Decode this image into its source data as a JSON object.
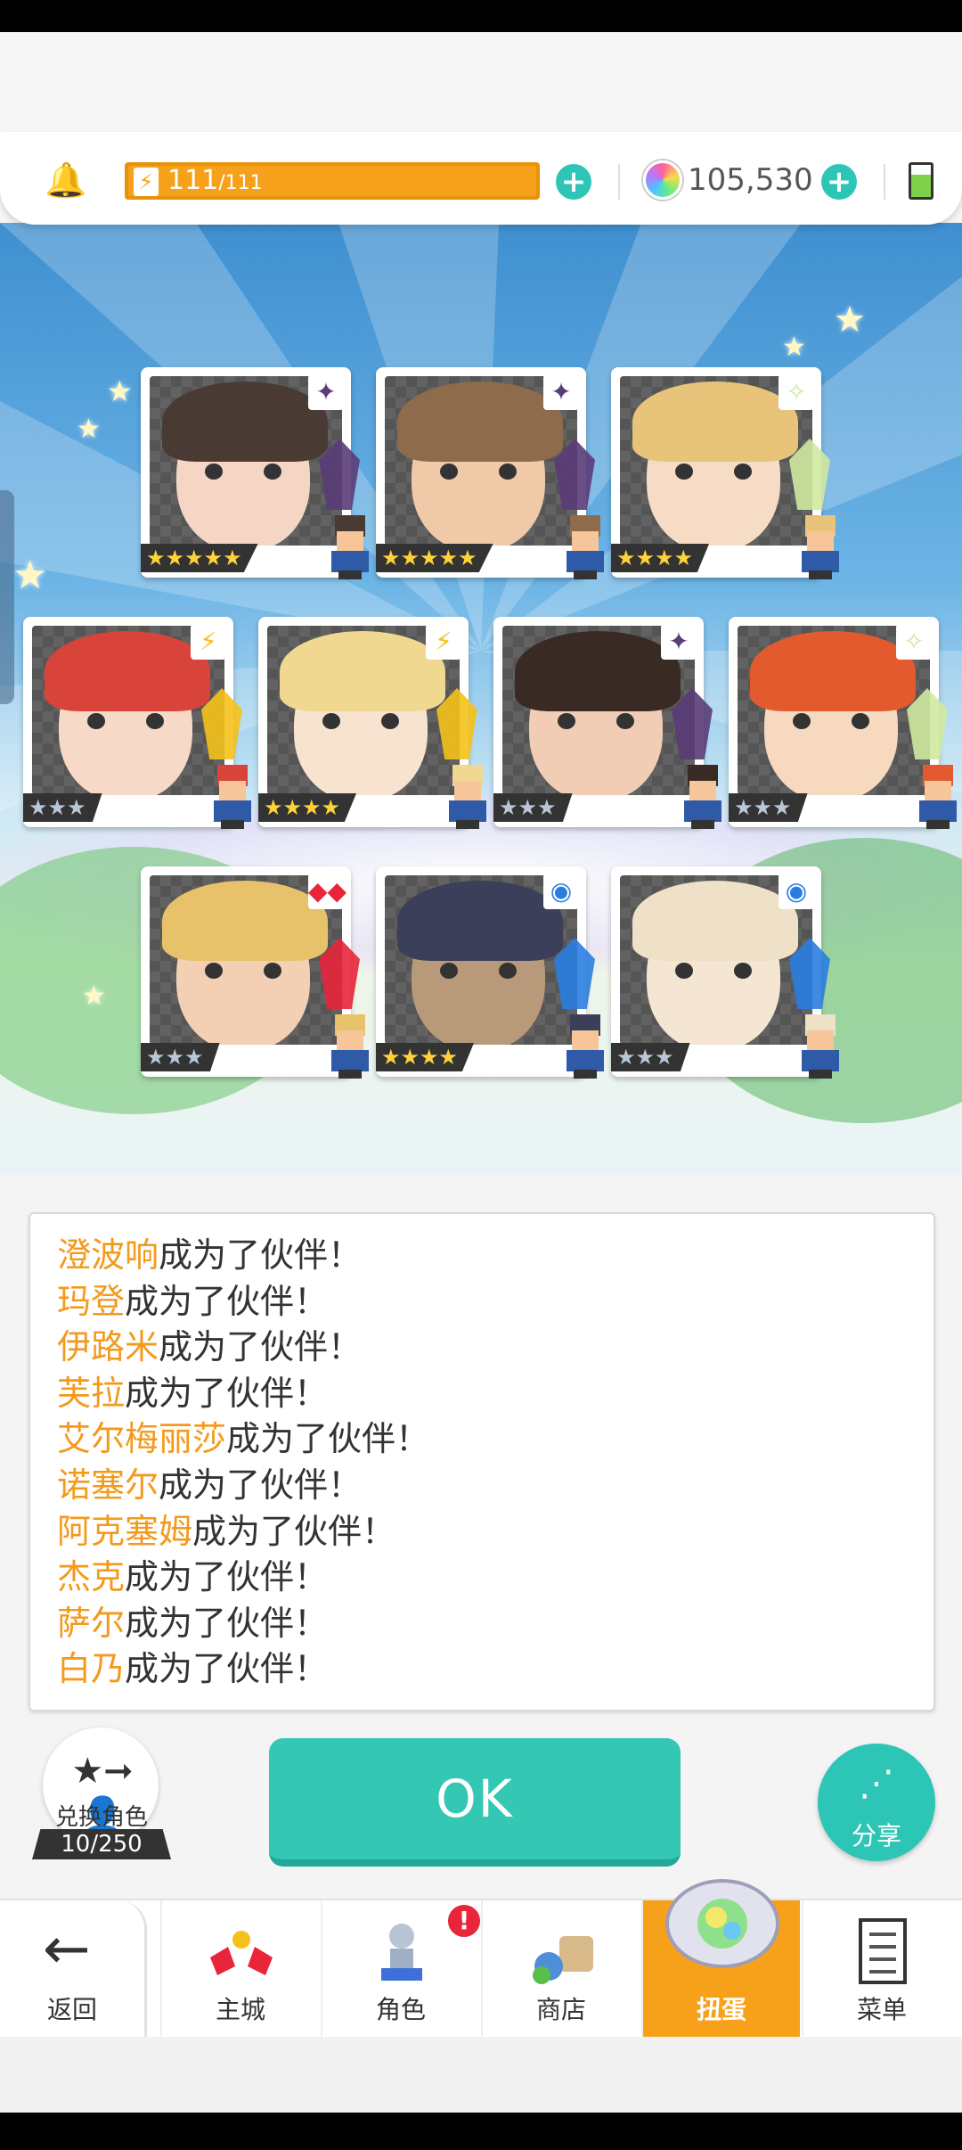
{
  "header": {
    "stamina_current": "111",
    "stamina_max": "/111",
    "gems": "105,530",
    "colors": {
      "stamina": "#f7a11a",
      "accent": "#2cc5b6"
    }
  },
  "cards": [
    {
      "stars": "★★★★★",
      "element": "✦",
      "element_color": "#5a3c78",
      "hair": "#4a3a34",
      "skin": "#f5d5c4"
    },
    {
      "stars": "★★★★★",
      "element": "✦",
      "element_color": "#5a3c78",
      "hair": "#8e6b4a",
      "skin": "#f0c9a8"
    },
    {
      "stars": "★★★★",
      "element": "✧",
      "element_color": "#cfe9a0",
      "hair": "#e8c47a",
      "skin": "#f7dcc5"
    },
    {
      "stars": "★★★",
      "element": "⚡",
      "element_color": "#f4c11a",
      "hair": "#d9443a",
      "skin": "#f6d9c6"
    },
    {
      "stars": "★★★★",
      "element": "⚡",
      "element_color": "#f4c11a",
      "hair": "#f0d890",
      "skin": "#f8e2d0"
    },
    {
      "stars": "★★★",
      "element": "✦",
      "element_color": "#5a3c78",
      "hair": "#3a2a24",
      "skin": "#f2cdb5"
    },
    {
      "stars": "★★★",
      "element": "✧",
      "element_color": "#cfe9a0",
      "hair": "#e35a2e",
      "skin": "#f7d9c0"
    },
    {
      "stars": "★★★",
      "element": "◆◆",
      "element_color": "#e8253a",
      "hair": "#e8c26a",
      "skin": "#f3cfb4"
    },
    {
      "stars": "★★★★",
      "element": "◉",
      "element_color": "#2a7de0",
      "hair": "#3b3f5a",
      "skin": "#b89a7a"
    },
    {
      "stars": "★★★",
      "element": "◉",
      "element_color": "#2a7de0",
      "hair": "#efe0c8",
      "skin": "#f4e6d2"
    }
  ],
  "messages": [
    {
      "name": "澄波响",
      "suffix": "成为了伙伴！"
    },
    {
      "name": "玛登",
      "suffix": "成为了伙伴！"
    },
    {
      "name": "伊路米",
      "suffix": "成为了伙伴！"
    },
    {
      "name": "芙拉",
      "suffix": "成为了伙伴！"
    },
    {
      "name": "艾尔梅丽莎",
      "suffix": "成为了伙伴！"
    },
    {
      "name": "诺塞尔",
      "suffix": "成为了伙伴！"
    },
    {
      "name": "阿克塞姆",
      "suffix": "成为了伙伴！"
    },
    {
      "name": "杰克",
      "suffix": "成为了伙伴！"
    },
    {
      "name": "萨尔",
      "suffix": "成为了伙伴！"
    },
    {
      "name": "白乃",
      "suffix": "成为了伙伴！"
    }
  ],
  "actions": {
    "swap_label": "兑换角色",
    "swap_count": "10/250",
    "ok_label": "OK",
    "share_label": "分享"
  },
  "nav": {
    "back": "返回",
    "town": "主城",
    "character": "角色",
    "character_badge": "!",
    "shop": "商店",
    "gacha": "扭蛋",
    "menu": "菜单"
  },
  "icons": {
    "bell": "bell-icon",
    "stamina": "lightning-icon",
    "gem": "gem-icon",
    "battery": "battery-icon",
    "back": "arrow-left-icon",
    "share": "share-icon",
    "swap": "swap-character-icon"
  }
}
